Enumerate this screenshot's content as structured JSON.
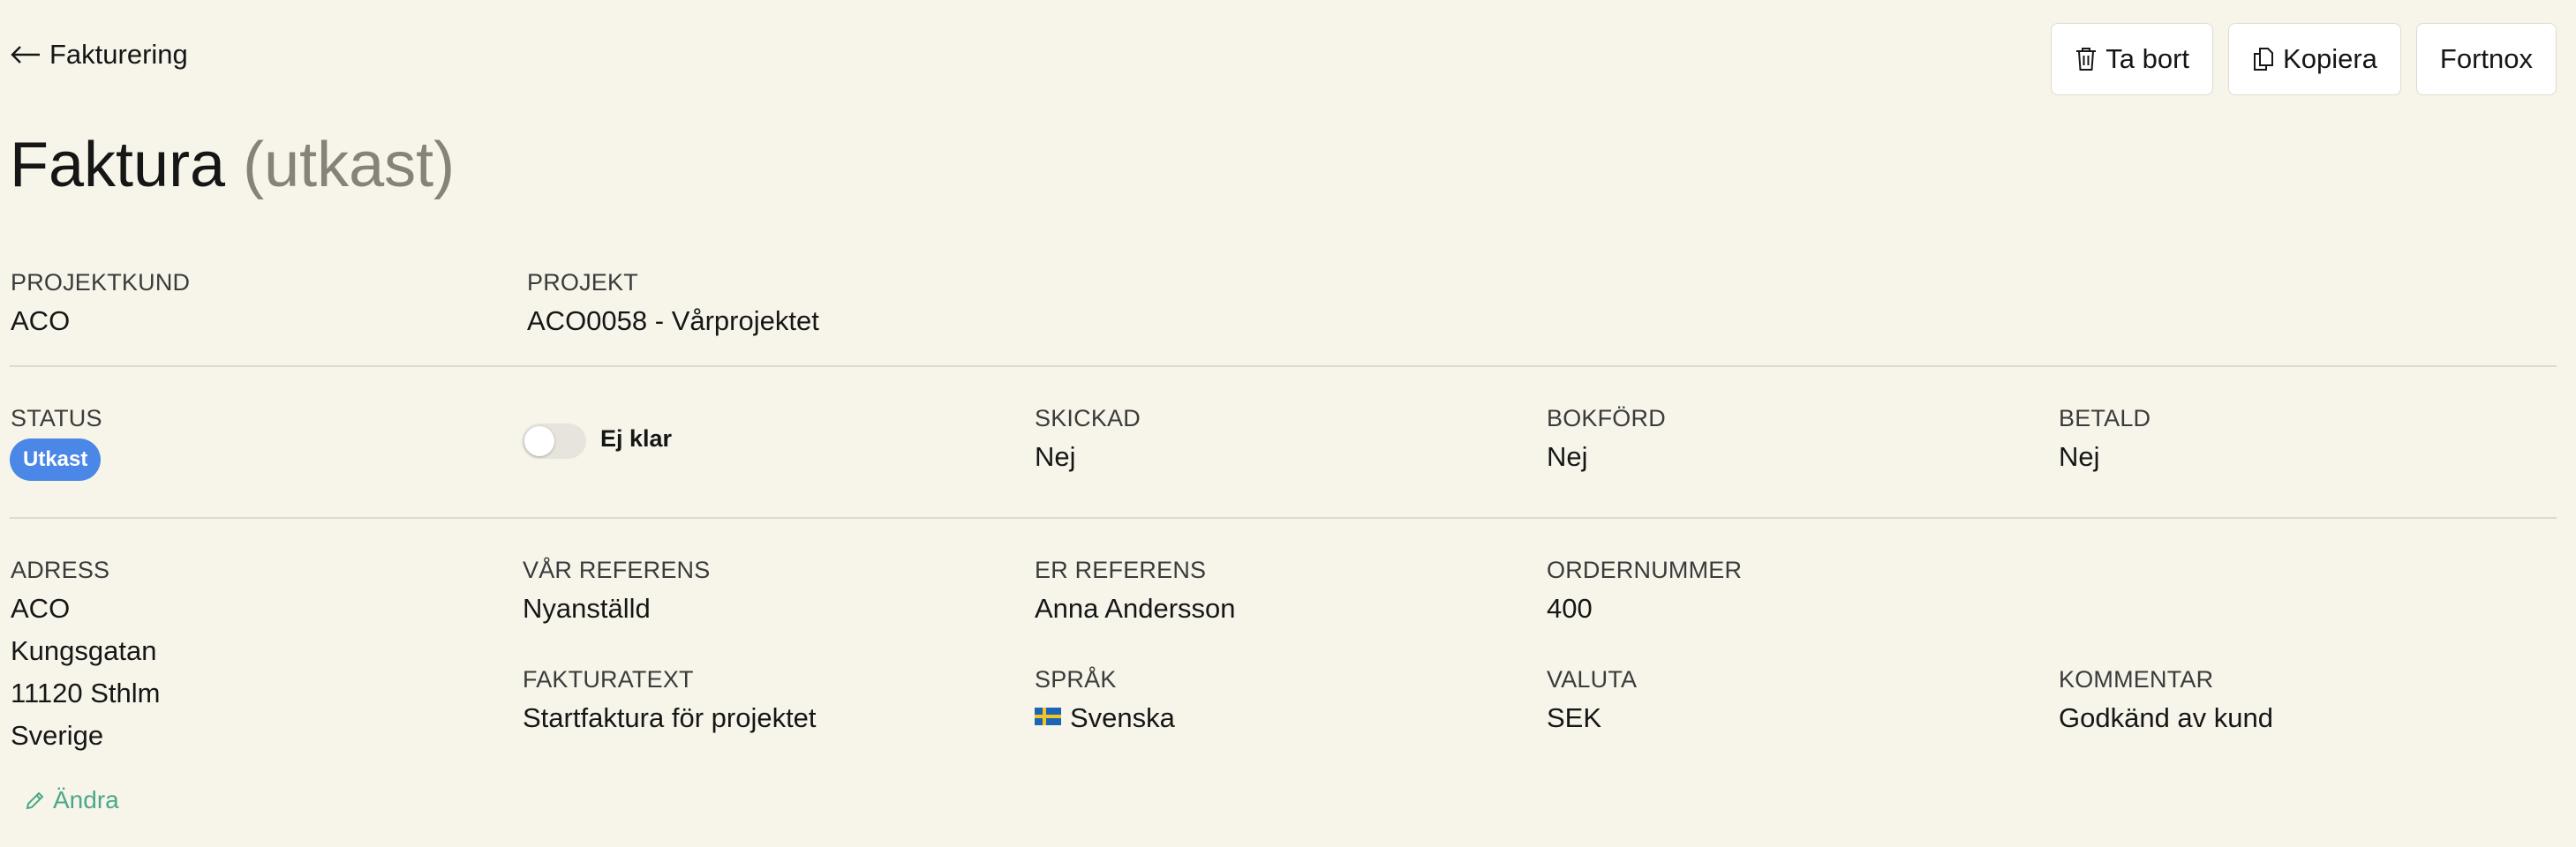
{
  "nav": {
    "back_label": "Fakturering"
  },
  "toolbar": {
    "delete_label": "Ta bort",
    "copy_label": "Kopiera",
    "fortnox_label": "Fortnox"
  },
  "title": {
    "main": "Faktura",
    "status": "(utkast)"
  },
  "project": {
    "customer_label": "PROJEKTKUND",
    "customer_value": "ACO",
    "project_label": "PROJEKT",
    "project_value": "ACO0058 - Vårprojektet"
  },
  "status": {
    "status_label": "STATUS",
    "status_badge": "Utkast",
    "toggle_label": "Ej klar",
    "toggle_on": false,
    "sent_label": "SKICKAD",
    "sent_value": "Nej",
    "booked_label": "BOKFÖRD",
    "booked_value": "Nej",
    "paid_label": "BETALD",
    "paid_value": "Nej"
  },
  "details": {
    "address_label": "ADRESS",
    "address_lines": [
      "ACO",
      "Kungsgatan",
      "11120 Sthlm",
      "Sverige"
    ],
    "our_ref_label": "VÅR REFERENS",
    "our_ref_value": "Nyanställd",
    "your_ref_label": "ER REFERENS",
    "your_ref_value": "Anna Andersson",
    "order_label": "ORDERNUMMER",
    "order_value": "400",
    "invoice_text_label": "FAKTURATEXT",
    "invoice_text_value": "Startfaktura för projektet",
    "language_label": "SPRÅK",
    "language_value": "Svenska",
    "currency_label": "VALUTA",
    "currency_value": "SEK",
    "comment_label": "KOMMENTAR",
    "comment_value": "Godkänd av kund",
    "edit_label": "Ändra"
  },
  "colors": {
    "background": "#f7f5ea",
    "badge": "#4a87e6",
    "edit_link": "#4aa888",
    "muted_title": "#85837a"
  },
  "icons": {
    "back": "arrow-left-icon",
    "delete": "trash-icon",
    "copy": "copy-icon",
    "edit": "pencil-icon",
    "language": "sweden-flag-icon"
  }
}
